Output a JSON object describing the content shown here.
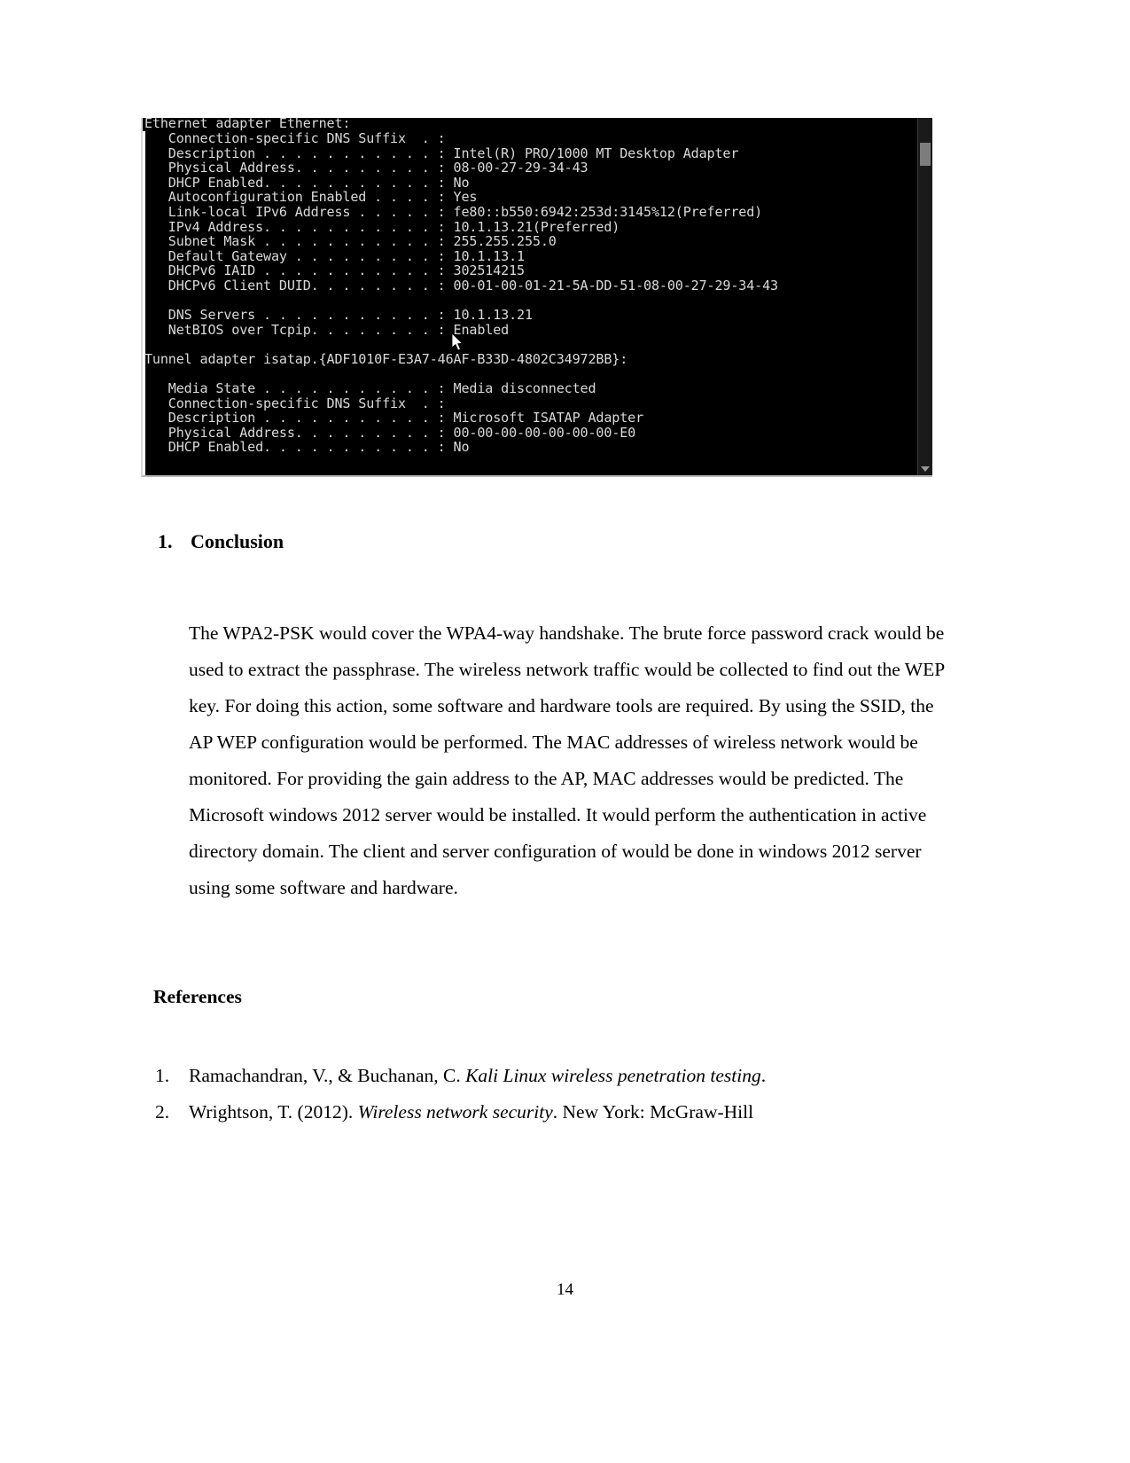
{
  "document": {
    "page_number": "14",
    "section": {
      "number": "1.",
      "title": "Conclusion"
    },
    "conclusion_paragraph": "The WPA2-PSK would cover the WPA4-way handshake. The brute force password crack would be used to extract the passphrase. The wireless network traffic would be collected to find out the WEP key. For doing this action, some software and hardware tools are required. By using the SSID, the AP WEP configuration would be performed. The MAC addresses of wireless network would be monitored. For providing the gain address to the AP, MAC addresses would be predicted. The Microsoft windows 2012 server would be installed. It would perform the authentication in active directory domain. The client and server configuration of would be done in windows 2012 server using some software and hardware.",
    "references_heading": "References",
    "references": [
      {
        "number": "1.",
        "pre": "Ramachandran, V., & Buchanan, C. ",
        "italic": "Kali Linux wireless penetration testing",
        "post": "."
      },
      {
        "number": "2.",
        "pre": "Wrightson, T. (2012). ",
        "italic": "Wireless network security",
        "post": ". New York: McGraw-Hill"
      }
    ]
  },
  "console_screenshot": {
    "title_line": "Ethernet adapter Ethernet:",
    "lines": [
      "   Connection-specific DNS Suffix  . :",
      "   Description . . . . . . . . . . . : Intel(R) PRO/1000 MT Desktop Adapter",
      "   Physical Address. . . . . . . . . : 08-00-27-29-34-43",
      "   DHCP Enabled. . . . . . . . . . . : No",
      "   Autoconfiguration Enabled . . . . : Yes",
      "   Link-local IPv6 Address . . . . . : fe80::b550:6942:253d:3145%12(Preferred)",
      "   IPv4 Address. . . . . . . . . . . : 10.1.13.21(Preferred)",
      "   Subnet Mask . . . . . . . . . . . : 255.255.255.0",
      "   Default Gateway . . . . . . . . . : 10.1.13.1",
      "   DHCPv6 IAID . . . . . . . . . . . : 302514215",
      "   DHCPv6 Client DUID. . . . . . . . : 00-01-00-01-21-5A-DD-51-08-00-27-29-34-43",
      "",
      "   DNS Servers . . . . . . . . . . . : 10.1.13.21",
      "   NetBIOS over Tcpip. . . . . . . . : Enabled",
      "",
      "Tunnel adapter isatap.{ADF1010F-E3A7-46AF-B33D-4802C34972BB}:",
      "",
      "   Media State . . . . . . . . . . . : Media disconnected",
      "   Connection-specific DNS Suffix  . :",
      "   Description . . . . . . . . . . . : Microsoft ISATAP Adapter",
      "   Physical Address. . . . . . . . . : 00-00-00-00-00-00-00-E0",
      "   DHCP Enabled. . . . . . . . . . . : No"
    ],
    "colors": {
      "background": "#000000",
      "text": "#d9d9d9",
      "scrollbar_track": "#1a1a1a",
      "scrollbar_thumb": "#7d7d7d"
    }
  }
}
